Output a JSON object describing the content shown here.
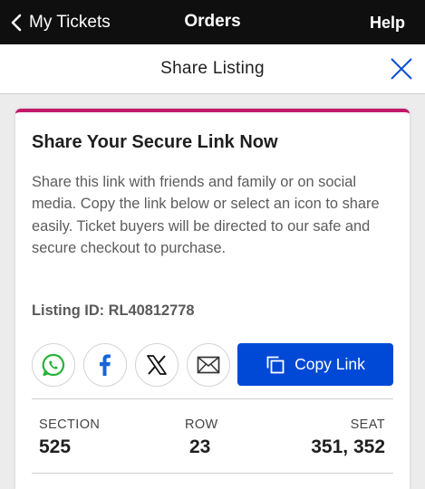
{
  "topbar": {
    "back_label": "My Tickets",
    "title": "Orders",
    "help_label": "Help"
  },
  "subbar": {
    "title": "Share Listing"
  },
  "card": {
    "accent_color": "#c2196b",
    "title": "Share Your Secure Link Now",
    "description": "Share this link with friends and family or on social media. Copy the link below or select an icon to share easily. Ticket buyers will be directed to our safe and secure checkout to purchase.",
    "listing_id": "Listing ID: RL40812778",
    "share_icons": [
      "whatsapp-icon",
      "facebook-icon",
      "x-icon",
      "mail-icon"
    ],
    "copy_label": "Copy Link",
    "copy_button_color": "#0049d6"
  },
  "seat_info": {
    "section_label": "SECTION",
    "section_value": "525",
    "row_label": "ROW",
    "row_value": "23",
    "seat_label": "SEAT",
    "seat_value": "351, 352"
  }
}
